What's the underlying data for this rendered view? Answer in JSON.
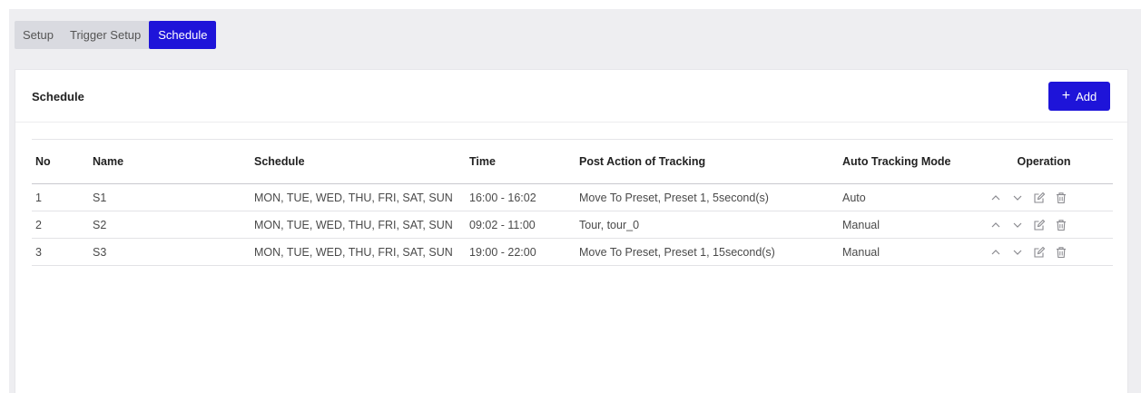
{
  "tabs": [
    {
      "label": "Setup"
    },
    {
      "label": "Trigger Setup"
    },
    {
      "label": "Schedule"
    }
  ],
  "card": {
    "title": "Schedule",
    "add_label": "Add"
  },
  "table": {
    "headers": {
      "no": "No",
      "name": "Name",
      "schedule": "Schedule",
      "time": "Time",
      "post_action": "Post Action of Tracking",
      "mode": "Auto Tracking Mode",
      "operation": "Operation"
    },
    "rows": [
      {
        "no": "1",
        "name": "S1",
        "schedule": "MON, TUE, WED, THU, FRI, SAT, SUN",
        "time": "16:00 - 16:02",
        "post_action": "Move To Preset, Preset 1, 5second(s)",
        "mode": "Auto"
      },
      {
        "no": "2",
        "name": "S2",
        "schedule": "MON, TUE, WED, THU, FRI, SAT, SUN",
        "time": "09:02 - 11:00",
        "post_action": "Tour, tour_0",
        "mode": "Manual"
      },
      {
        "no": "3",
        "name": "S3",
        "schedule": "MON, TUE, WED, THU, FRI, SAT, SUN",
        "time": "19:00 - 22:00",
        "post_action": "Move To Preset, Preset 1, 15second(s)",
        "mode": "Manual"
      }
    ]
  },
  "colors": {
    "accent": "#1e14d9",
    "background": "#eeeef1",
    "tab_bar": "#d9dae0",
    "icon": "#8a8a8f"
  },
  "icons": {
    "add": "plus-icon",
    "move_up": "chevron-up-icon",
    "move_down": "chevron-down-icon",
    "edit": "edit-icon",
    "delete": "trash-icon"
  }
}
